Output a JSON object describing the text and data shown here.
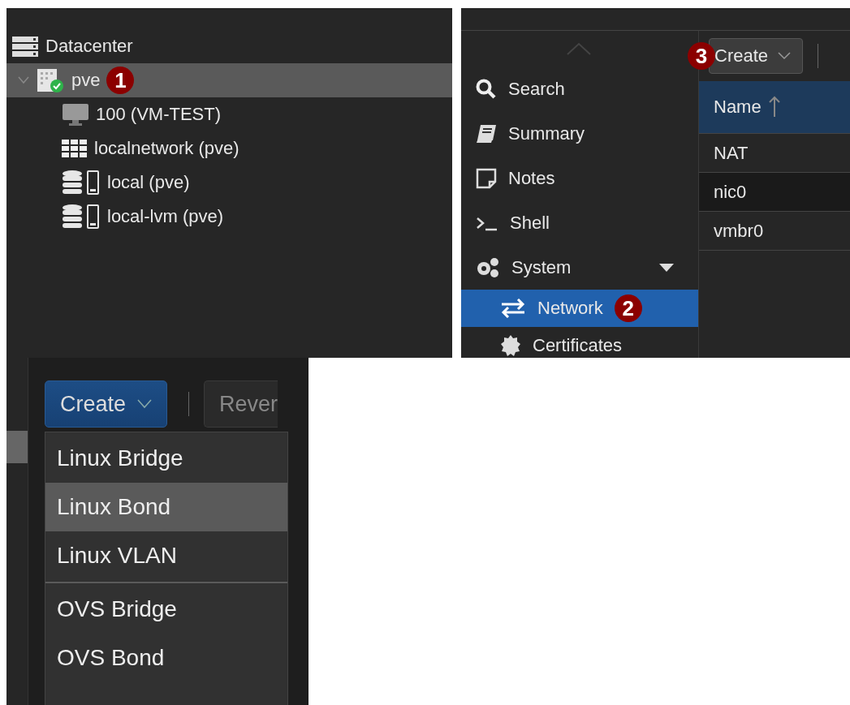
{
  "tree": {
    "items": [
      {
        "label": "Datacenter",
        "kind": "datacenter",
        "selected": false,
        "children": [
          {
            "label": "pve",
            "kind": "node",
            "selected": true,
            "expanded": true,
            "badge": "1",
            "children": [
              {
                "label": "100 (VM-TEST)",
                "kind": "vm",
                "selected": false
              },
              {
                "label": "localnetwork (pve)",
                "kind": "sdn",
                "selected": false
              },
              {
                "label": "local (pve)",
                "kind": "storage",
                "selected": false
              },
              {
                "label": "local-lvm (pve)",
                "kind": "storage",
                "selected": false
              }
            ]
          }
        ]
      }
    ]
  },
  "nav": {
    "items": [
      {
        "label": "Search",
        "kind": "search",
        "selected": false
      },
      {
        "label": "Summary",
        "kind": "summary",
        "selected": false
      },
      {
        "label": "Notes",
        "kind": "notes",
        "selected": false
      },
      {
        "label": "Shell",
        "kind": "shell",
        "selected": false
      },
      {
        "label": "System",
        "kind": "system",
        "selected": false,
        "expanded": true,
        "children": [
          {
            "label": "Network",
            "kind": "network",
            "selected": true,
            "badge": "2"
          },
          {
            "label": "Certificates",
            "kind": "certificates",
            "selected": false
          }
        ]
      }
    ]
  },
  "toolbar": {
    "create_button": {
      "label": "Create",
      "badge": "3"
    }
  },
  "table": {
    "columns": [
      {
        "label": "Name",
        "sorted_ascending": true
      }
    ],
    "rows": [
      {
        "name": "NAT",
        "selected": false
      },
      {
        "name": "nic0",
        "selected": true
      },
      {
        "name": "vmbr0",
        "selected": false
      }
    ]
  },
  "create_panel": {
    "buttons": [
      {
        "label": "Create",
        "kind": "primary"
      },
      {
        "label": "Rever",
        "kind": "secondary"
      }
    ],
    "menu": [
      {
        "kind": "item",
        "label": "Linux Bridge",
        "selected": false
      },
      {
        "kind": "item",
        "label": "Linux Bond",
        "selected": true
      },
      {
        "kind": "item",
        "label": "Linux VLAN",
        "selected": false
      },
      {
        "kind": "separator"
      },
      {
        "kind": "item",
        "label": "OVS Bridge",
        "selected": false
      },
      {
        "kind": "item",
        "label": "OVS Bond",
        "selected": false
      }
    ]
  }
}
